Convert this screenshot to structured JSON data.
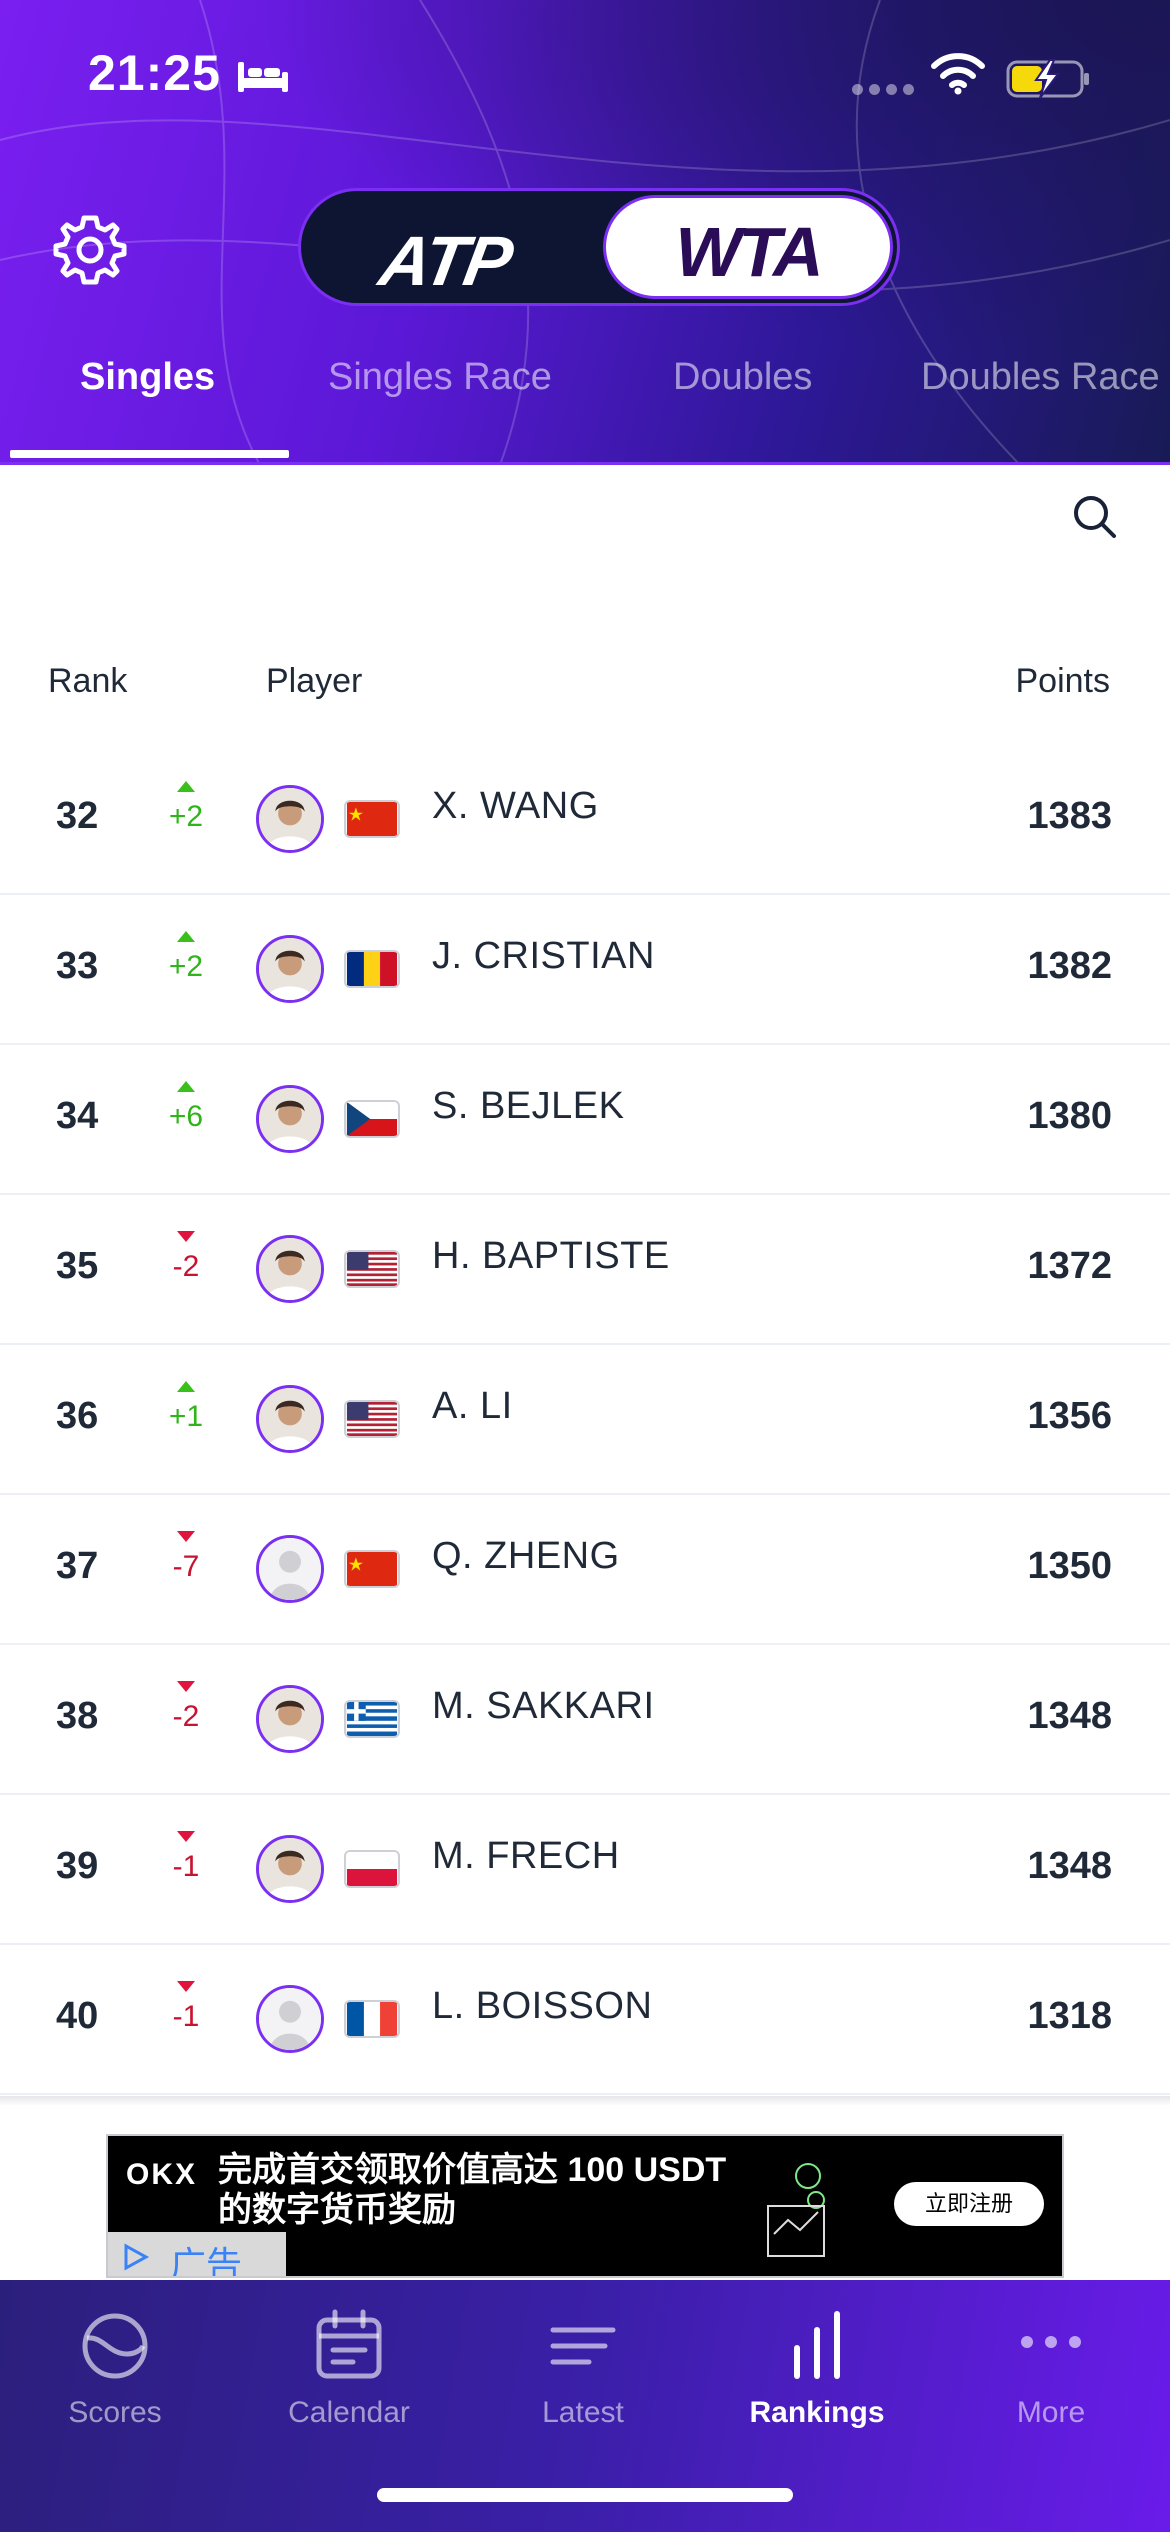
{
  "status_bar": {
    "time": "21:25"
  },
  "tour_toggle": {
    "left": "ATP",
    "right": "WTA",
    "selected": "WTA"
  },
  "tabs": [
    "Singles",
    "Singles Race",
    "Doubles",
    "Doubles Race"
  ],
  "active_tab": "Singles",
  "columns": {
    "rank": "Rank",
    "player": "Player",
    "points": "Points"
  },
  "rankings": [
    {
      "rank": "32",
      "direction": "up",
      "delta": "+2",
      "name": "X. WANG",
      "country": "CHN",
      "points": "1383",
      "has_photo": true
    },
    {
      "rank": "33",
      "direction": "up",
      "delta": "+2",
      "name": "J. CRISTIAN",
      "country": "ROU",
      "points": "1382",
      "has_photo": true
    },
    {
      "rank": "34",
      "direction": "up",
      "delta": "+6",
      "name": "S. BEJLEK",
      "country": "CZE",
      "points": "1380",
      "has_photo": true
    },
    {
      "rank": "35",
      "direction": "down",
      "delta": "-2",
      "name": "H. BAPTISTE",
      "country": "USA",
      "points": "1372",
      "has_photo": true
    },
    {
      "rank": "36",
      "direction": "up",
      "delta": "+1",
      "name": "A. LI",
      "country": "USA",
      "points": "1356",
      "has_photo": true
    },
    {
      "rank": "37",
      "direction": "down",
      "delta": "-7",
      "name": "Q. ZHENG",
      "country": "CHN",
      "points": "1350",
      "has_photo": false
    },
    {
      "rank": "38",
      "direction": "down",
      "delta": "-2",
      "name": "M. SAKKARI",
      "country": "GRE",
      "points": "1348",
      "has_photo": true
    },
    {
      "rank": "39",
      "direction": "down",
      "delta": "-1",
      "name": "M. FRECH",
      "country": "POL",
      "points": "1348",
      "has_photo": true
    },
    {
      "rank": "40",
      "direction": "down",
      "delta": "-1",
      "name": "L. BOISSON",
      "country": "FRA",
      "points": "1318",
      "has_photo": false
    }
  ],
  "ad": {
    "logo": "OKX",
    "headline_1": "完成首交领取价值高达 100 USDT",
    "headline_2": "的数字货币奖励",
    "cta": "立即注册",
    "badge": "广告"
  },
  "bottom_nav": [
    {
      "label": "Scores",
      "icon": "tennis-ball-icon"
    },
    {
      "label": "Calendar",
      "icon": "calendar-icon"
    },
    {
      "label": "Latest",
      "icon": "news-lines-icon"
    },
    {
      "label": "Rankings",
      "icon": "bar-chart-icon"
    },
    {
      "label": "More",
      "icon": "more-dots-icon"
    }
  ],
  "active_nav": "Rankings",
  "colors": {
    "brand_purple": "#7b2ff2",
    "header_dark": "#181a55",
    "up_green": "#2fb41a",
    "down_red": "#c8122f"
  }
}
